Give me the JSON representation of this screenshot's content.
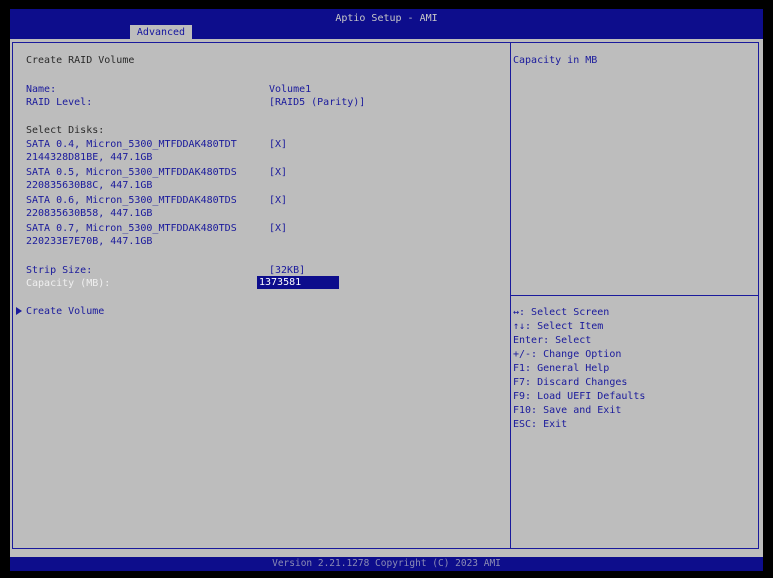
{
  "header": {
    "title": "Aptio Setup - AMI",
    "active_tab": "Advanced"
  },
  "main": {
    "section_title": "Create RAID Volume",
    "name_label": "Name:",
    "name_value": "Volume1",
    "raid_level_label": "RAID Level:",
    "raid_level_value": "[RAID5 (Parity)]",
    "select_disks_label": "Select Disks:",
    "disks": [
      {
        "line1": "SATA 0.4, Micron_5300_MTFDDAK480TDT",
        "line2": "2144328D81BE, 447.1GB",
        "value": "[X]"
      },
      {
        "line1": "SATA 0.5, Micron_5300_MTFDDAK480TDS",
        "line2": "220835630B8C, 447.1GB",
        "value": "[X]"
      },
      {
        "line1": "SATA 0.6, Micron_5300_MTFDDAK480TDS",
        "line2": "220835630B58, 447.1GB",
        "value": "[X]"
      },
      {
        "line1": "SATA 0.7, Micron_5300_MTFDDAK480TDS",
        "line2": "220233E7E70B, 447.1GB",
        "value": "[X]"
      }
    ],
    "strip_size_label": "Strip Size:",
    "strip_size_value": "[32KB]",
    "capacity_label": "Capacity (MB):",
    "capacity_value": "1373581",
    "create_volume_label": "Create Volume"
  },
  "help": {
    "text": "Capacity in MB"
  },
  "keys": [
    "↔: Select Screen",
    "↑↓: Select Item",
    "Enter: Select",
    "+/-: Change Option",
    "F1: General Help",
    "F7: Discard Changes",
    "F9: Load UEFI Defaults",
    "F10: Save and Exit",
    "ESC: Exit"
  ],
  "footer": {
    "text": "Version 2.21.1278 Copyright (C) 2023 AMI"
  },
  "colors": {
    "background": "#bdbdbd",
    "bar": "#0d0d8c",
    "text_blue": "#1a1a9c"
  }
}
